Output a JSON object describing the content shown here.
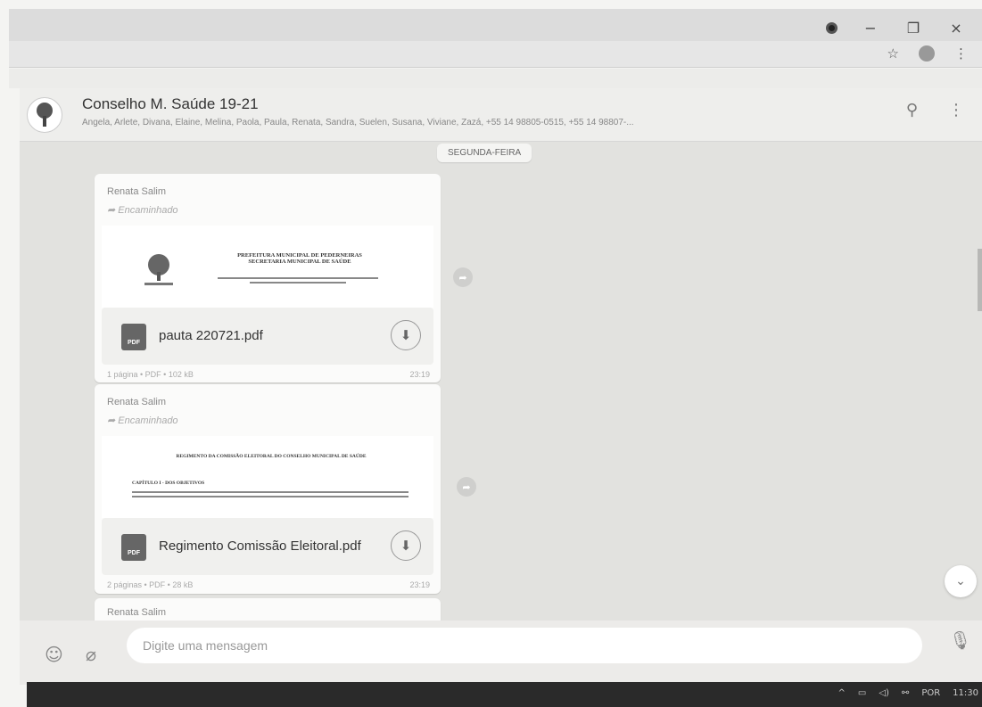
{
  "browser": {
    "window_controls": {
      "minimize": "−",
      "maximize": "❐",
      "close": "×"
    },
    "toolbar_icons": [
      "star-icon",
      "profile-icon",
      "menu-icon"
    ]
  },
  "chat": {
    "title": "Conselho M. Saúde 19-21",
    "members": "Angela, Arlete, Divana, Elaine, Melina, Paola, Paula, Renata, Sandra, Suelen, Susana, Viviane, Zazá, +55 14 98805-0515, +55 14 98807-...",
    "date_divider": "SEGUNDA-FEIRA"
  },
  "messages": [
    {
      "sender": "Renata Salim",
      "forwarded": "Encaminhado",
      "preview_heading_1": "PREFEITURA MUNICIPAL DE PEDERNEIRAS",
      "preview_heading_2": "SECRETARIA MUNICIPAL DE SAÚDE",
      "file_name": "pauta 220721.pdf",
      "file_type_label": "PDF",
      "meta": "1 página • PDF • 102 kB",
      "time": "23:19"
    },
    {
      "sender": "Renata Salim",
      "forwarded": "Encaminhado",
      "preview_heading_1": "REGIMENTO DA COMISSÃO ELEITORAL DO CONSELHO MUNICIPAL DE SAÚDE",
      "preview_heading_2": "CAPÍTULO I - DOS OBJETIVOS",
      "file_name": "Regimento Comissão Eleitoral.pdf",
      "file_type_label": "PDF",
      "meta": "2 páginas • PDF • 28 kB",
      "time": "23:19"
    },
    {
      "sender": "Renata Salim"
    }
  ],
  "compose": {
    "placeholder": "Digite uma mensagem"
  },
  "taskbar": {
    "language": "POR",
    "time": "11:30"
  }
}
